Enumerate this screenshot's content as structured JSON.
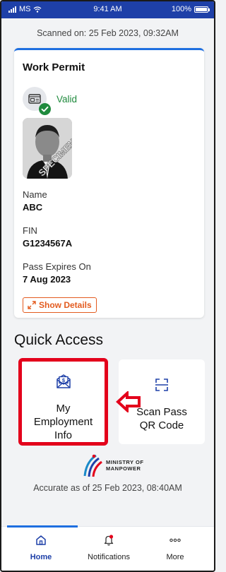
{
  "status_bar": {
    "carrier": "MS",
    "time": "9:41 AM",
    "battery": "100%"
  },
  "scanned_on": "Scanned on: 25 Feb 2023, 09:32AM",
  "card": {
    "title": "Work Permit",
    "status": "Valid",
    "photo_watermark": "SPECIMEN",
    "fields": [
      {
        "label": "Name",
        "value": "ABC"
      },
      {
        "label": "FIN",
        "value": "G1234567A"
      },
      {
        "label": "Pass Expires On",
        "value": "7 Aug 2023"
      }
    ],
    "show_details_label": "Show Details"
  },
  "quick_access": {
    "title": "Quick Access",
    "tiles": [
      {
        "label_lines": [
          "My",
          "Employment",
          "Info"
        ],
        "icon": "envelope-dollar-icon"
      },
      {
        "label_lines": [
          "Scan Pass",
          "QR Code"
        ],
        "icon": "scan-frame-icon"
      }
    ]
  },
  "logo": {
    "line1": "MINISTRY OF",
    "line2": "MANPOWER"
  },
  "accurate_as_of": "Accurate as of 25 Feb 2023, 08:40AM",
  "bottom_nav": {
    "items": [
      {
        "label": "Home",
        "icon": "home-icon"
      },
      {
        "label": "Notifications",
        "icon": "bell-icon"
      },
      {
        "label": "More",
        "icon": "more-dots-icon"
      }
    ]
  },
  "colors": {
    "brand_blue": "#1e40a8",
    "accent_blue": "#1f6fe0",
    "valid_green": "#1f8a3d",
    "action_orange": "#e35b1f",
    "highlight_red": "#e3001b"
  }
}
